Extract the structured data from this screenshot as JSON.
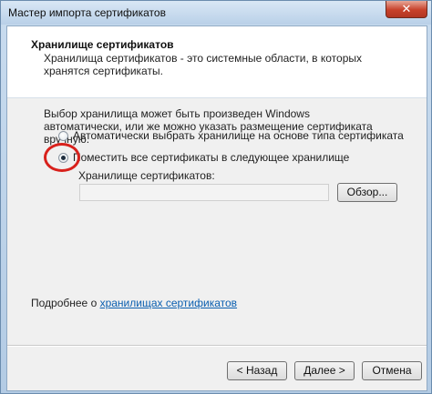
{
  "window": {
    "title": "Мастер импорта сертификатов",
    "close_glyph": "✕"
  },
  "header": {
    "title": "Хранилище сертификатов",
    "description": "Хранилища сертификатов - это системные области, в которых хранятся сертификаты."
  },
  "body": {
    "intro": "Выбор хранилища может быть произведен Windows автоматически, или же можно указать размещение сертификата вручную.",
    "options": [
      {
        "label": "Автоматически выбрать хранилище на основе типа сертификата",
        "selected": false
      },
      {
        "label": "Поместить все сертификаты в следующее хранилище",
        "selected": true
      }
    ],
    "store_label": "Хранилище сертификатов:",
    "store_value": "",
    "browse_label": "Обзор...",
    "more_info_prefix": "Подробнее о ",
    "more_info_link": "хранилищах сертификатов"
  },
  "footer": {
    "back_label": "< Назад",
    "next_label": "Далее >",
    "cancel_label": "Отмена"
  },
  "colors": {
    "highlight_ring": "#d8211c",
    "link": "#0b5fb0",
    "close_button": "#c7412a"
  },
  "icons": {
    "close": "close-icon"
  }
}
